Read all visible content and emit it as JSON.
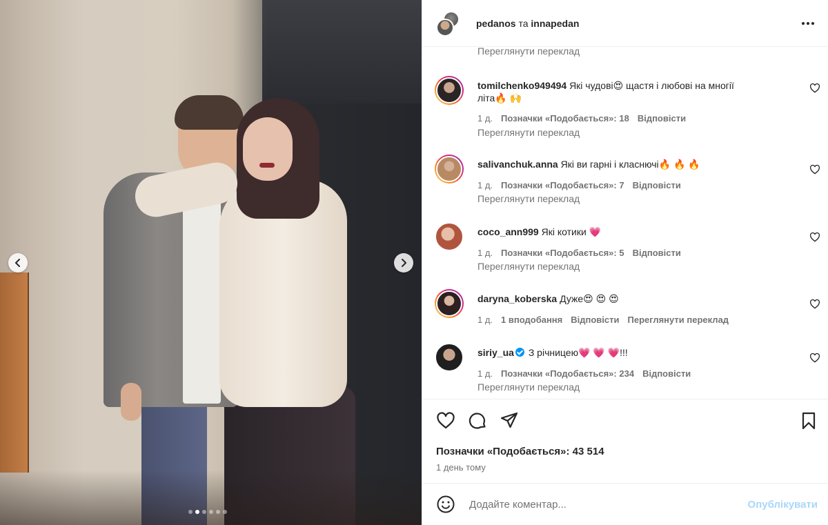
{
  "header": {
    "user1": "pedanos",
    "and": "та",
    "user2": "innapedan"
  },
  "top_translate": "Переглянути переклад",
  "comments": [
    {
      "username": "tomilchenko949494",
      "text_line1": "Які чудові😍 щастя і любові на многії",
      "text_line2": "літа🔥 🙌",
      "age": "1 д.",
      "likes": "Позначки «Подобається»: 18",
      "reply": "Відповісти",
      "translate": "Переглянути переклад"
    },
    {
      "username": "salivanchuk.anna",
      "text": "Які ви гарні і класнючі🔥 🔥 🔥",
      "age": "1 д.",
      "likes": "Позначки «Подобається»: 7",
      "reply": "Відповісти",
      "translate": "Переглянути переклад"
    },
    {
      "username": "coco_ann999",
      "text": "Які котики 💗",
      "age": "1 д.",
      "likes": "Позначки «Подобається»: 5",
      "reply": "Відповісти",
      "translate": "Переглянути переклад"
    },
    {
      "username": "daryna_koberska",
      "text": "Дуже😍 😍 😍",
      "age": "1 д.",
      "likes": "1 вподобання",
      "reply": "Відповісти",
      "translate": "Переглянути переклад"
    },
    {
      "username": "siriy_ua",
      "text": "З річницею💗 💗 💗!!!",
      "age": "1 д.",
      "likes": "Позначки «Подобається»: 234",
      "reply": "Відповісти",
      "translate": "Переглянути переклад"
    }
  ],
  "post": {
    "likes": "Позначки «Подобається»: 43 514",
    "time": "1 день тому"
  },
  "add_comment": {
    "placeholder": "Додайте коментар...",
    "publish": "Опублікувати"
  },
  "carousel": {
    "count": 6,
    "active_index": 1
  },
  "icons": {
    "nav_prev": "chevron-left-icon",
    "nav_next": "chevron-right-icon",
    "like": "heart-icon",
    "comment": "comment-icon",
    "share": "send-icon",
    "save": "bookmark-icon",
    "more": "more-icon",
    "emoji": "smile-icon"
  },
  "colors": {
    "publish_disabled": "#a8d7fb",
    "verified": "#0095f6",
    "secondary_text": "#737373"
  }
}
